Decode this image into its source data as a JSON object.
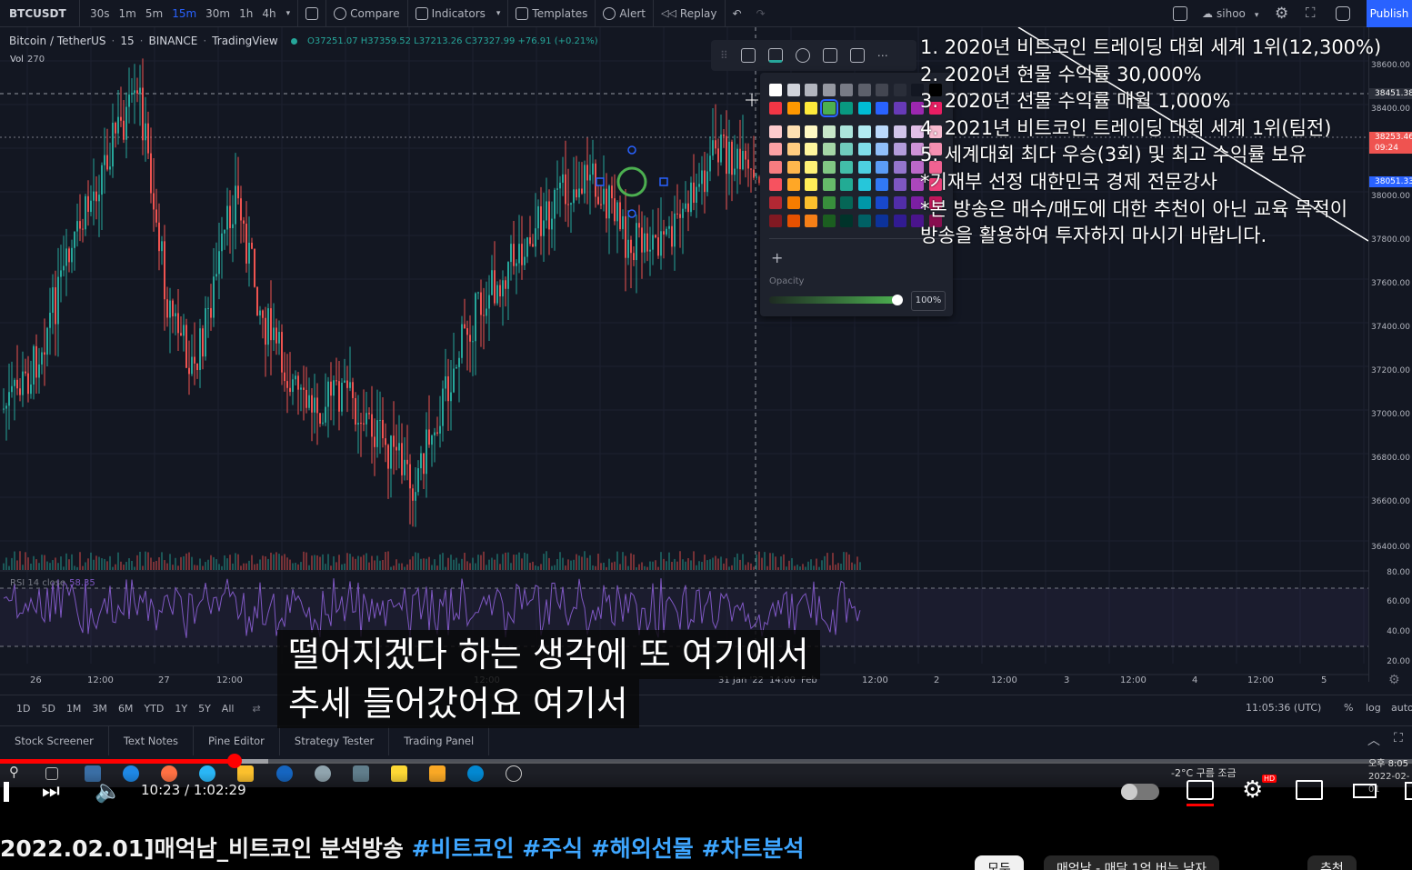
{
  "topbar": {
    "symbol": "BTCUSDT",
    "intervals": [
      "30s",
      "1m",
      "5m",
      "15m",
      "30m",
      "1h",
      "4h"
    ],
    "active_interval": "15m",
    "compare": "Compare",
    "indicators": "Indicators",
    "templates": "Templates",
    "alert": "Alert",
    "replay": "Replay",
    "user": "sihoo",
    "publish": "Publish"
  },
  "legend": {
    "pair": "Bitcoin / TetherUS",
    "interval": "15",
    "exchange": "BINANCE",
    "source": "TradingView",
    "ohlc": "O37251.07 H37359.52 L37213.26 C37327.99 +76.91 (+0.21%)",
    "vol_label": "Vol",
    "vol_value": "270"
  },
  "price_axis": {
    "labels": [
      "38600.00",
      "38400.00",
      "38000.00",
      "37800.00",
      "37600.00",
      "37400.00",
      "37200.00",
      "37000.00",
      "36800.00",
      "36600.00",
      "36400.00"
    ],
    "tags": [
      {
        "text": "38451.38",
        "color": "#2a2e39"
      },
      {
        "text": "38253.46",
        "color": "#ef5350"
      },
      {
        "text": "09:24",
        "color": "#ef5350"
      },
      {
        "text": "38051.33",
        "color": "#2962ff"
      }
    ],
    "rsi_labels": [
      "80.00",
      "60.00",
      "40.00",
      "20.00"
    ]
  },
  "time_axis": [
    "26",
    "12:00",
    "27",
    "12:00",
    "12:00",
    "31 Jan '22",
    "14:00",
    "Feb",
    "12:00",
    "2",
    "12:00",
    "3",
    "12:00",
    "4",
    "12:00",
    "5"
  ],
  "rsi": {
    "label": "RSI 14 close",
    "value": "58.35"
  },
  "range_bar": [
    "1D",
    "5D",
    "1M",
    "3M",
    "6M",
    "YTD",
    "1Y",
    "5Y",
    "All"
  ],
  "clock": "11:05:36 (UTC)",
  "scale_opts": {
    "pct": "%",
    "log": "log",
    "auto": "auto"
  },
  "panel_tabs": [
    "Stock Screener",
    "Text Notes",
    "Pine Editor",
    "Strategy Tester",
    "Trading Panel"
  ],
  "palette": {
    "opacity_label": "Opacity",
    "opacity_value": "100%",
    "plus": "+"
  },
  "overlay_lines": [
    "1. 2020년 비트코인 트레이딩 대회 세계 1위(12,300%)",
    "2. 2020년 현물 수익률 30,000%",
    "3. 2020년 선물 수익률 매월 1,000%",
    "4. 2021년 비트코인 트레이딩 대회 세계 1위(팀전)",
    "5. 세계대회 최다 우승(3회) 및 최고 수익률 보유",
    "*기재부 선정 대한민국 경제 전문강사",
    "*본 방송은 매수/매도에 대한 추천이 아닌 교육 목적이",
    " 방송을 활용하여 투자하지 마시기 바랍니다."
  ],
  "subtitles": [
    "떨어지겠다 하는 생각에 또 여기에서",
    "추세 들어갔어요 여기서"
  ],
  "taskbar": {
    "weather": "-2°C 구름 조금",
    "time": "오후 8:05",
    "date": "2022-02-01"
  },
  "player": {
    "time": "10:23 / 1:02:29",
    "progress": 0.166,
    "buffered": 0.19
  },
  "video": {
    "title_main": "2022.02.01]매억남_비트코인 분석방송 ",
    "tags": [
      "#비트코인",
      "#주식",
      "#해외선물",
      "#차트분석"
    ]
  },
  "chips": [
    "모두",
    "매억남 - 매달 1억 버는 남자",
    "추천"
  ]
}
